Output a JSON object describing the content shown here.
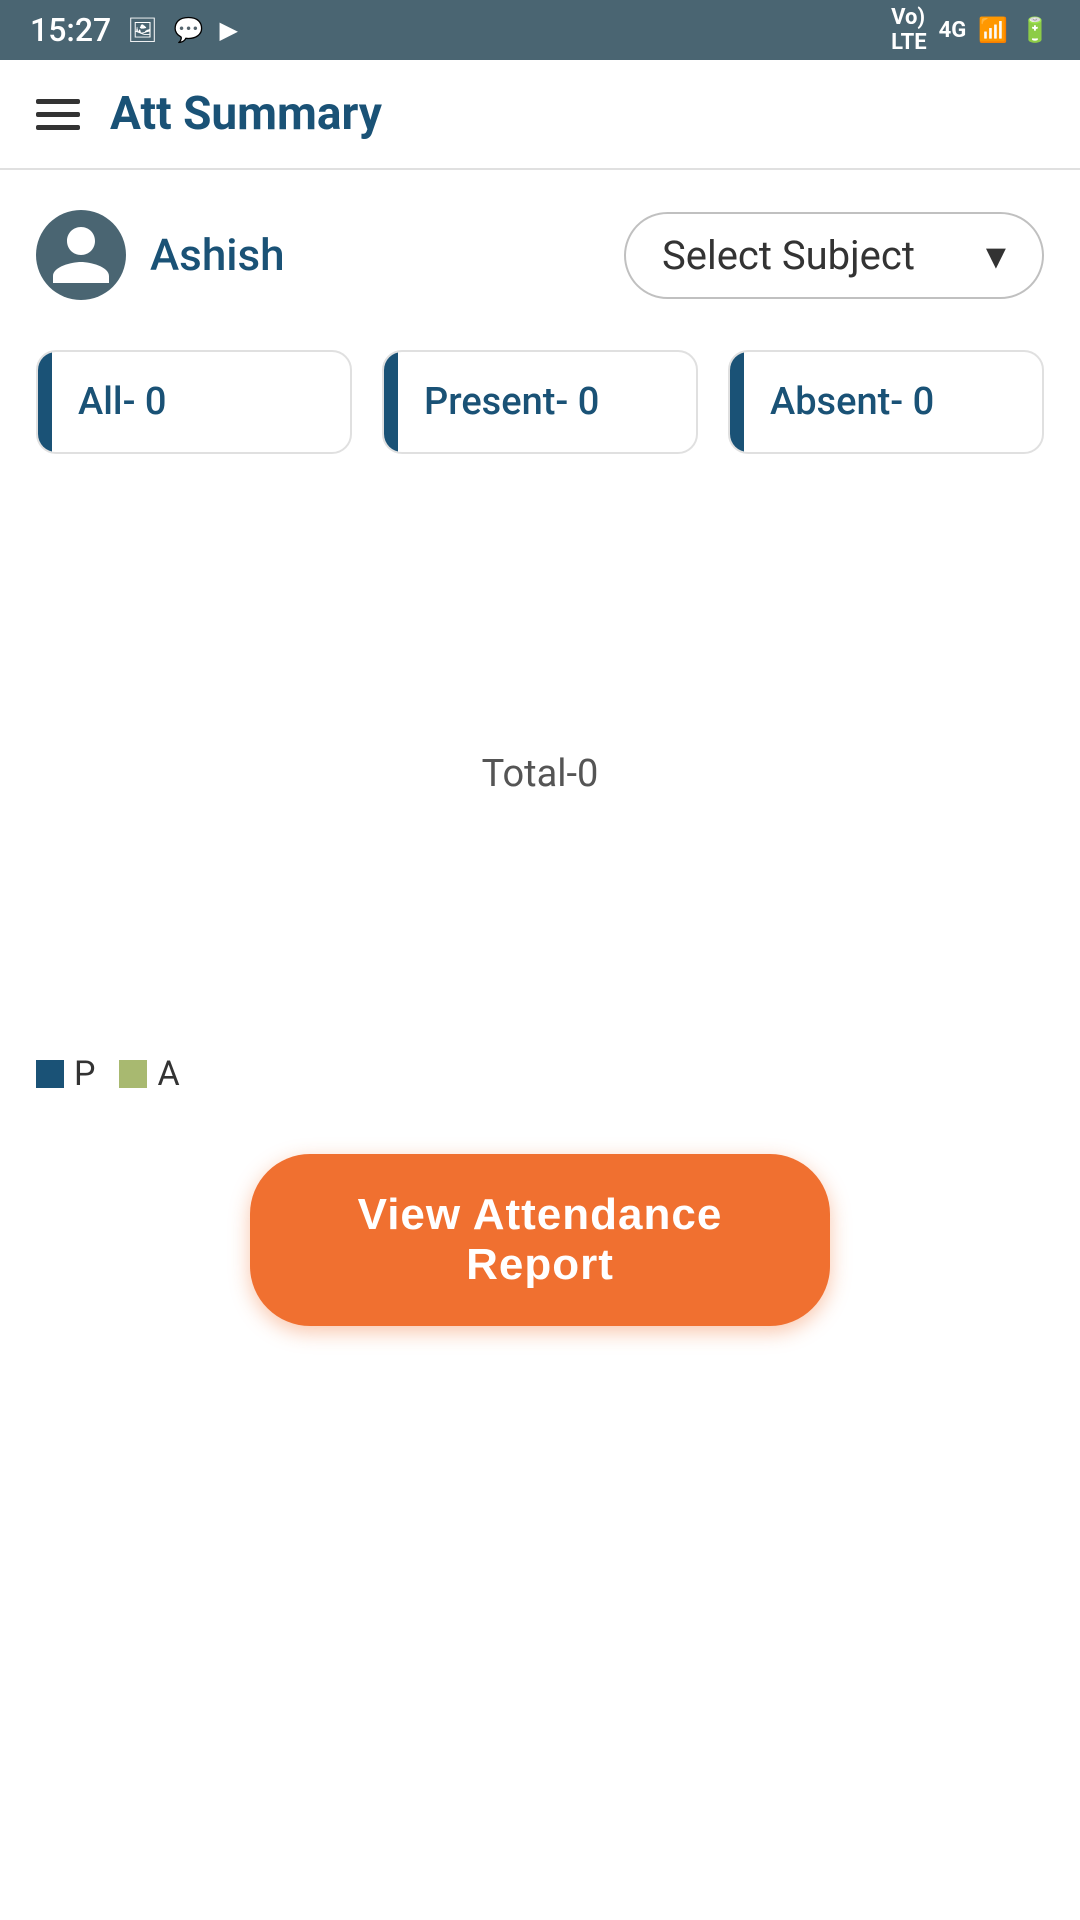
{
  "statusBar": {
    "time": "15:27",
    "icons": [
      "image-icon",
      "chat-icon",
      "youtube-icon",
      "volte-icon",
      "4g-icon",
      "signal-icon",
      "battery-icon"
    ]
  },
  "appBar": {
    "title": "Att Summary",
    "menuIcon": "hamburger-icon"
  },
  "user": {
    "name": "Ashish",
    "avatarIcon": "person-icon"
  },
  "subjectDropdown": {
    "label": "Select Subject",
    "chevron": "▾"
  },
  "stats": {
    "all": "All- 0",
    "present": "Present- 0",
    "absent": "Absent- 0"
  },
  "chart": {
    "totalLabel": "Total-0"
  },
  "legend": {
    "presentLabel": "P",
    "absentLabel": "A"
  },
  "button": {
    "viewAttendance": "View  Attendance  Report"
  }
}
